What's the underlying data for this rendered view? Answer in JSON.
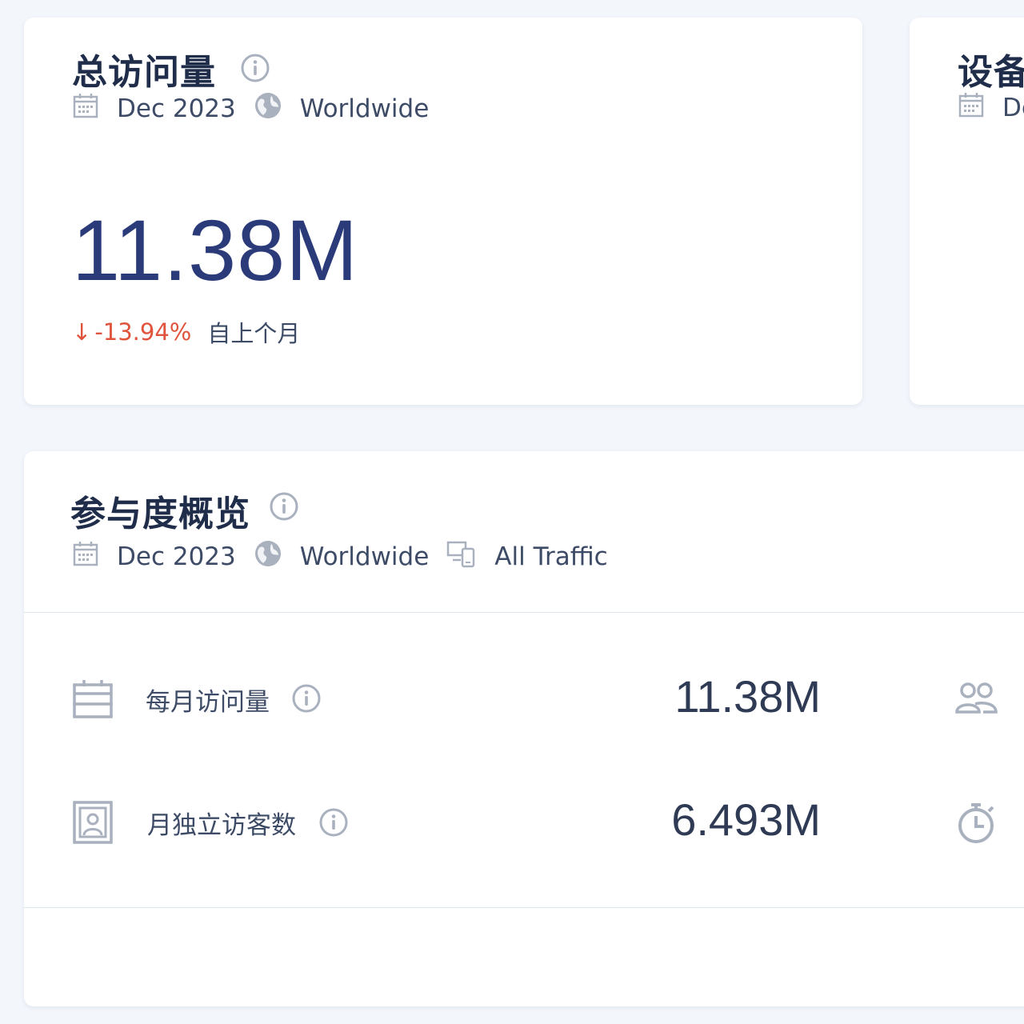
{
  "visits_card": {
    "title": "总访问量",
    "date": "Dec 2023",
    "region": "Worldwide",
    "total": "11.38M",
    "change": "-13.94%",
    "change_arrow": "↓",
    "change_caption": "自上个月",
    "change_color": "#e0533d"
  },
  "device_card": {
    "title": "设备",
    "date": "De"
  },
  "engagement_card": {
    "title": "参与度概览",
    "date": "Dec 2023",
    "region": "Worldwide",
    "traffic": "All Traffic",
    "rows": [
      {
        "label": "每月访问量",
        "value": "11.38M",
        "icon": "calendar-icon"
      },
      {
        "label": "月独立访客数",
        "value": "6.493M",
        "icon": "visitor-card-icon"
      }
    ],
    "right_icons": [
      "users-icon",
      "stopwatch-icon"
    ]
  },
  "colors": {
    "background": "#f3f6fb",
    "accent_number": "#2b3a78",
    "negative": "#e0533d",
    "icon_gray": "#a9b1bf"
  }
}
